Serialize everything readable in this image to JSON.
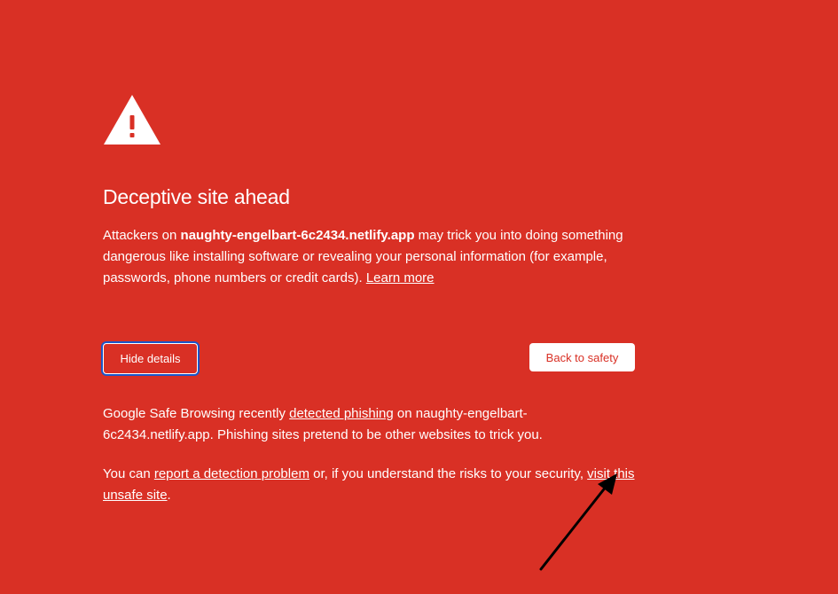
{
  "page": {
    "heading": "Deceptive site ahead"
  },
  "intro": {
    "prefix": "Attackers on ",
    "host": "naughty-engelbart-6c2434.netlify.app",
    "suffix": " may trick you into doing something dangerous like installing software or revealing your personal information (for example, passwords, phone numbers or credit cards). ",
    "learn_more": "Learn more"
  },
  "buttons": {
    "hide_details": "Hide details",
    "back_to_safety": "Back to safety"
  },
  "details": {
    "p1_prefix": "Google Safe Browsing recently ",
    "p1_link": "detected phishing",
    "p1_suffix": " on naughty-engelbart-6c2434.netlify.app. Phishing sites pretend to be other websites to trick you.",
    "p2_prefix": "You can ",
    "p2_report_link": "report a detection problem",
    "p2_middle": " or, if you understand the risks to your security, ",
    "p2_visit_link": "visit this unsafe site",
    "p2_suffix": "."
  },
  "icons": {
    "warning": "warning-triangle-icon",
    "annotation": "annotation-arrow-icon"
  },
  "colors": {
    "background": "#d93025",
    "text": "#ffffff",
    "focus_ring": "#1a56c9",
    "arrow": "#000000"
  }
}
